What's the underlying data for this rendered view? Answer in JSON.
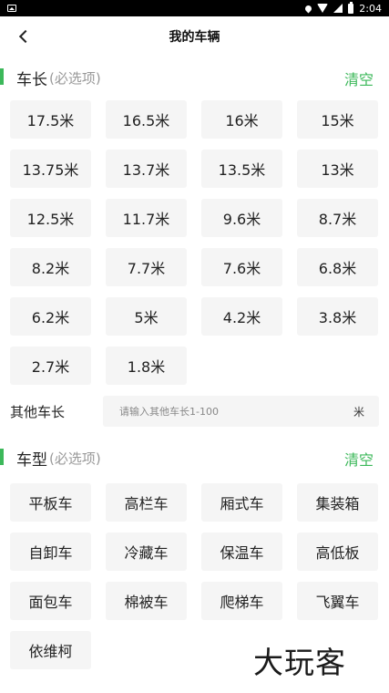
{
  "status_bar": {
    "time": "2:04"
  },
  "header": {
    "title": "我的车辆"
  },
  "length_section": {
    "title": "车长",
    "subtitle": "(必选项)",
    "clear_label": "清空",
    "options": [
      "17.5米",
      "16.5米",
      "16米",
      "15米",
      "13.75米",
      "13.7米",
      "13.5米",
      "13米",
      "12.5米",
      "11.7米",
      "9.6米",
      "8.7米",
      "8.2米",
      "7.7米",
      "7.6米",
      "6.8米",
      "6.2米",
      "5米",
      "4.2米",
      "3.8米",
      "2.7米",
      "1.8米"
    ],
    "other": {
      "label": "其他车长",
      "placeholder": "请输入其他车长1-100",
      "unit": "米"
    }
  },
  "type_section": {
    "title": "车型",
    "subtitle": "(必选项)",
    "clear_label": "清空",
    "options": [
      "平板车",
      "高栏车",
      "厢式车",
      "集装箱",
      "自卸车",
      "冷藏车",
      "保温车",
      "高低板",
      "面包车",
      "棉被车",
      "爬梯车",
      "飞翼车",
      "依维柯"
    ]
  },
  "watermark": {
    "text": "大玩客"
  }
}
